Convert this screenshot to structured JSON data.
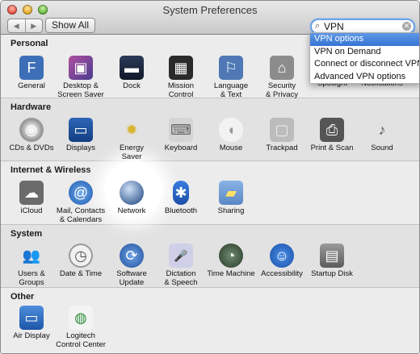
{
  "window": {
    "title": "System Preferences"
  },
  "toolbar": {
    "back_glyph": "◀",
    "forward_glyph": "▶",
    "show_all_label": "Show All"
  },
  "search": {
    "value": "VPN",
    "results": [
      "VPN options",
      "VPN on Demand",
      "Connect or disconnect VPN",
      "Advanced VPN options"
    ],
    "selected_index": 0
  },
  "sections": [
    {
      "title": "Personal",
      "items": [
        {
          "label": "General",
          "icon": "general-icon"
        },
        {
          "label": "Desktop &\nScreen Saver",
          "icon": "desktop-icon"
        },
        {
          "label": "Dock",
          "icon": "dock-icon"
        },
        {
          "label": "Mission\nControl",
          "icon": "mission-control-icon"
        },
        {
          "label": "Language\n& Text",
          "icon": "language-icon"
        },
        {
          "label": "Security\n& Privacy",
          "icon": "security-icon"
        },
        {
          "label": "Spotlight",
          "icon": "spotlight-icon"
        },
        {
          "label": "Notifications",
          "icon": "notifications-icon"
        }
      ]
    },
    {
      "title": "Hardware",
      "items": [
        {
          "label": "CDs & DVDs",
          "icon": "cd-icon"
        },
        {
          "label": "Displays",
          "icon": "display-icon"
        },
        {
          "label": "Energy\nSaver",
          "icon": "bulb-icon"
        },
        {
          "label": "Keyboard",
          "icon": "keyboard-icon"
        },
        {
          "label": "Mouse",
          "icon": "mouse-icon"
        },
        {
          "label": "Trackpad",
          "icon": "trackpad-icon"
        },
        {
          "label": "Print & Scan",
          "icon": "printer-icon"
        },
        {
          "label": "Sound",
          "icon": "speaker-icon"
        }
      ]
    },
    {
      "title": "Internet & Wireless",
      "items": [
        {
          "label": "iCloud",
          "icon": "cloud-icon"
        },
        {
          "label": "Mail, Contacts\n& Calendars",
          "icon": "at-icon"
        },
        {
          "label": "Network",
          "icon": "network-globe-icon"
        },
        {
          "label": "Bluetooth",
          "icon": "bluetooth-icon"
        },
        {
          "label": "Sharing",
          "icon": "sharing-folder-icon"
        }
      ]
    },
    {
      "title": "System",
      "items": [
        {
          "label": "Users &\nGroups",
          "icon": "users-icon"
        },
        {
          "label": "Date & Time",
          "icon": "clock-icon"
        },
        {
          "label": "Software\nUpdate",
          "icon": "update-icon"
        },
        {
          "label": "Dictation\n& Speech",
          "icon": "microphone-icon"
        },
        {
          "label": "Time Machine",
          "icon": "time-machine-icon"
        },
        {
          "label": "Accessibility",
          "icon": "accessibility-icon"
        },
        {
          "label": "Startup Disk",
          "icon": "disk-icon"
        }
      ]
    },
    {
      "title": "Other",
      "items": [
        {
          "label": "Air Display",
          "icon": "air-display-icon"
        },
        {
          "label": "Logitech\nControl Center",
          "icon": "logitech-icon"
        }
      ]
    }
  ],
  "icon_glyphs": {
    "personal": [
      "F",
      "▣",
      "▬",
      "▦",
      "⚐",
      "⌂",
      "",
      ""
    ],
    "hardware": [
      "◎",
      "▭",
      "✹",
      "⌨",
      "◖",
      "▢",
      "⎙",
      "♪"
    ],
    "internet": [
      "☁",
      "@",
      "●",
      "✱",
      "▰"
    ],
    "system": [
      "👥",
      "◷",
      "⟳",
      "🎤",
      "◔",
      "☺",
      "▤"
    ],
    "other": [
      "▭",
      "◍"
    ]
  },
  "colors": {
    "highlight": "#3675d6",
    "search_ring": "#6aa1e4"
  }
}
